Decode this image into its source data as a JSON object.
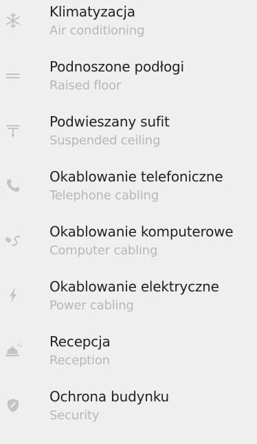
{
  "items": [
    {
      "title": "Klimatyzacja",
      "subtitle": "Air conditioning",
      "icon": "snowflake-icon"
    },
    {
      "title": "Podnoszone podłogi",
      "subtitle": "Raised floor",
      "icon": "raised-floor-icon"
    },
    {
      "title": "Podwieszany sufit",
      "subtitle": "Suspended ceiling",
      "icon": "suspended-ceiling-icon"
    },
    {
      "title": "Okablowanie telefoniczne",
      "subtitle": "Telephone cabling",
      "icon": "phone-icon"
    },
    {
      "title": "Okablowanie komputerowe",
      "subtitle": "Computer cabling",
      "icon": "computer-cable-icon"
    },
    {
      "title": "Okablowanie elektryczne",
      "subtitle": "Power cabling",
      "icon": "lightning-icon"
    },
    {
      "title": "Recepcja",
      "subtitle": "Reception",
      "icon": "reception-bell-icon"
    },
    {
      "title": "Ochrona budynku",
      "subtitle": "Security",
      "icon": "shield-icon"
    }
  ],
  "colors": {
    "background": "#efefef",
    "title": "#222222",
    "subtitle": "#b7b7b7",
    "icon": "#c4c4c4"
  }
}
